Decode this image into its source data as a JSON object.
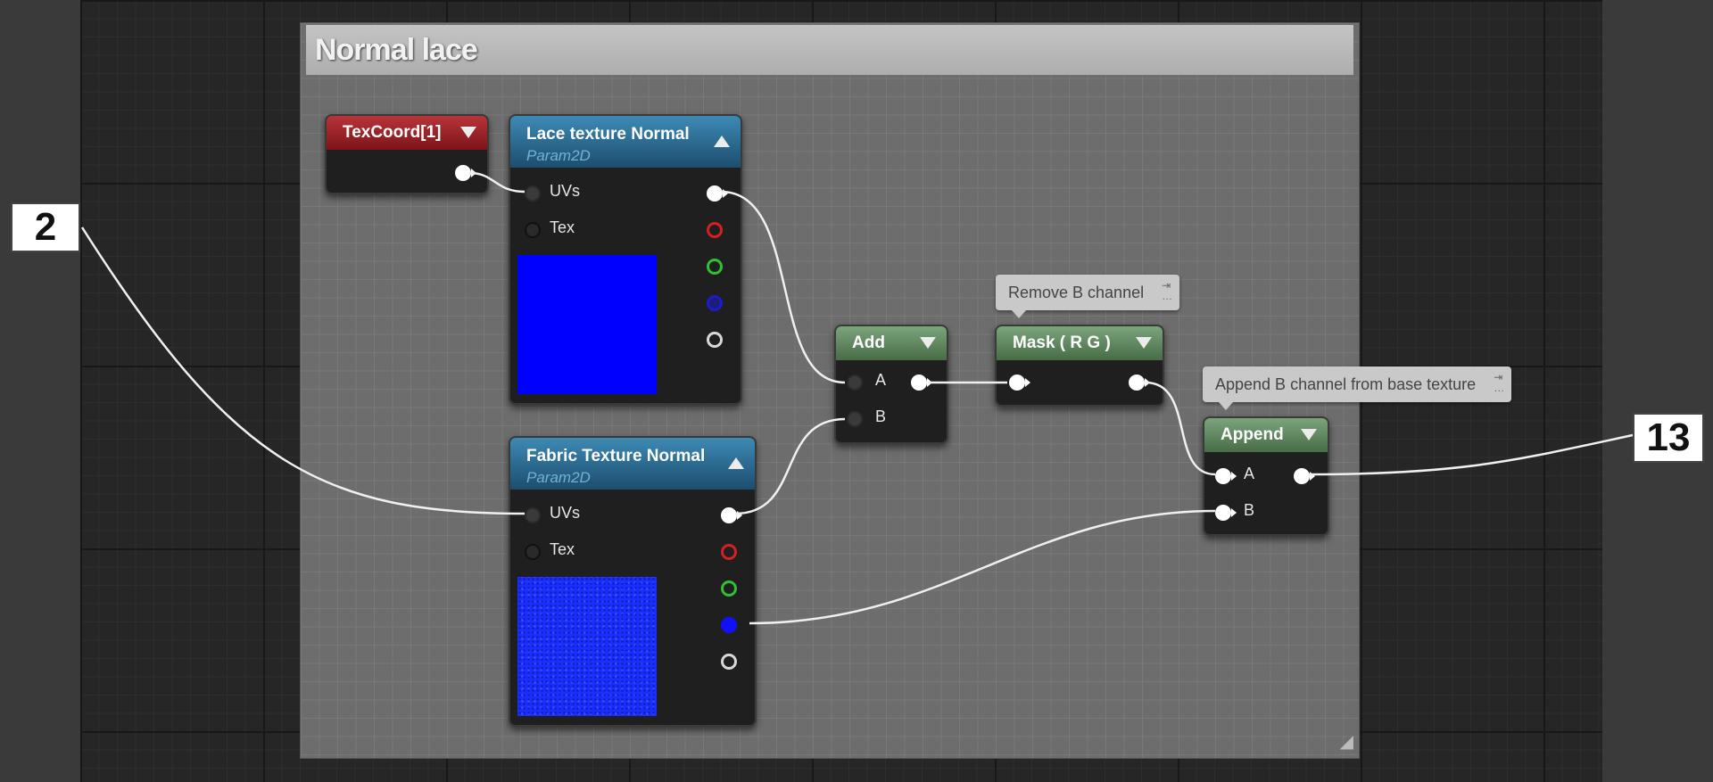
{
  "comment_box": {
    "title": "Normal lace"
  },
  "nodes": {
    "texcoord": {
      "title": "TexCoord[1]"
    },
    "lace_texture": {
      "title": "Lace texture Normal",
      "subtitle": "Param2D",
      "pins": {
        "uvs": "UVs",
        "tex": "Tex"
      },
      "swatch_color": "#0000ff"
    },
    "fabric_texture": {
      "title": "Fabric Texture Normal",
      "subtitle": "Param2D",
      "pins": {
        "uvs": "UVs",
        "tex": "Tex"
      },
      "swatch_color": "#1a2eff"
    },
    "add": {
      "title": "Add",
      "pins": {
        "a": "A",
        "b": "B"
      }
    },
    "mask": {
      "title": "Mask ( R G )"
    },
    "append": {
      "title": "Append",
      "pins": {
        "a": "A",
        "b": "B"
      }
    }
  },
  "bubbles": {
    "mask": "Remove B channel",
    "append": "Append B channel from base texture"
  },
  "callouts": {
    "left": "2",
    "right": "13"
  },
  "colors": {
    "header_red": "#9a2228",
    "header_blue": "#2d6e93",
    "header_green": "#5f8a5f",
    "pin_red": "#d42020",
    "pin_green": "#30c030",
    "pin_blue": "#1c1cc8",
    "pin_alpha": "#d8d8d8",
    "wire": "#f0f0f0"
  }
}
